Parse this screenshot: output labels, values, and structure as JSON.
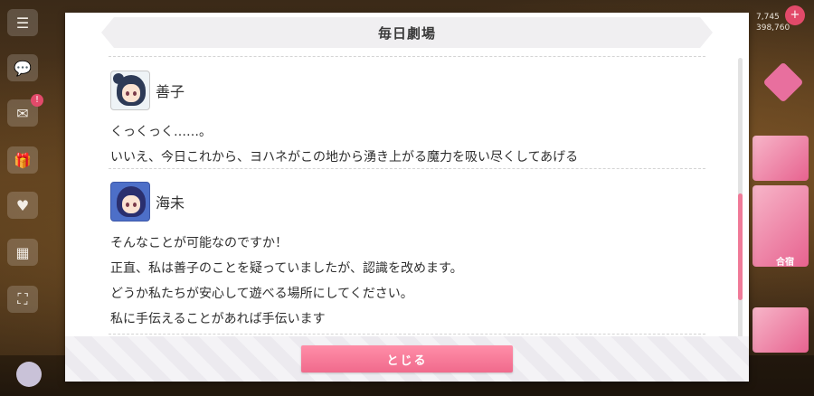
{
  "dialog": {
    "title": "毎日劇場",
    "entries": [
      {
        "speaker": "善子",
        "avatar_icon": "yoshiko-portrait-icon",
        "lines": [
          "くっくっく……。",
          "いいえ、今日これから、ヨハネがこの地から湧き上がる魔力を吸い尽くしてあげる"
        ]
      },
      {
        "speaker": "海未",
        "avatar_icon": "umi-portrait-icon",
        "lines": [
          "そんなことが可能なのですか！",
          "正直、私は善子のことを疑っていましたが、認識を改めます。",
          "どうか私たちが安心して遊べる場所にしてください。",
          "私に手伝えることがあれば手伝います"
        ]
      }
    ],
    "close_label": "とじる"
  },
  "background": {
    "currency_top": "7,745",
    "currency_bottom": "398,760",
    "side_label": "合宿",
    "badge_text": "!"
  },
  "colors": {
    "accent": "#f06a8c",
    "dialog_bg": "#ffffff",
    "title_bar": "#f0eff1"
  }
}
